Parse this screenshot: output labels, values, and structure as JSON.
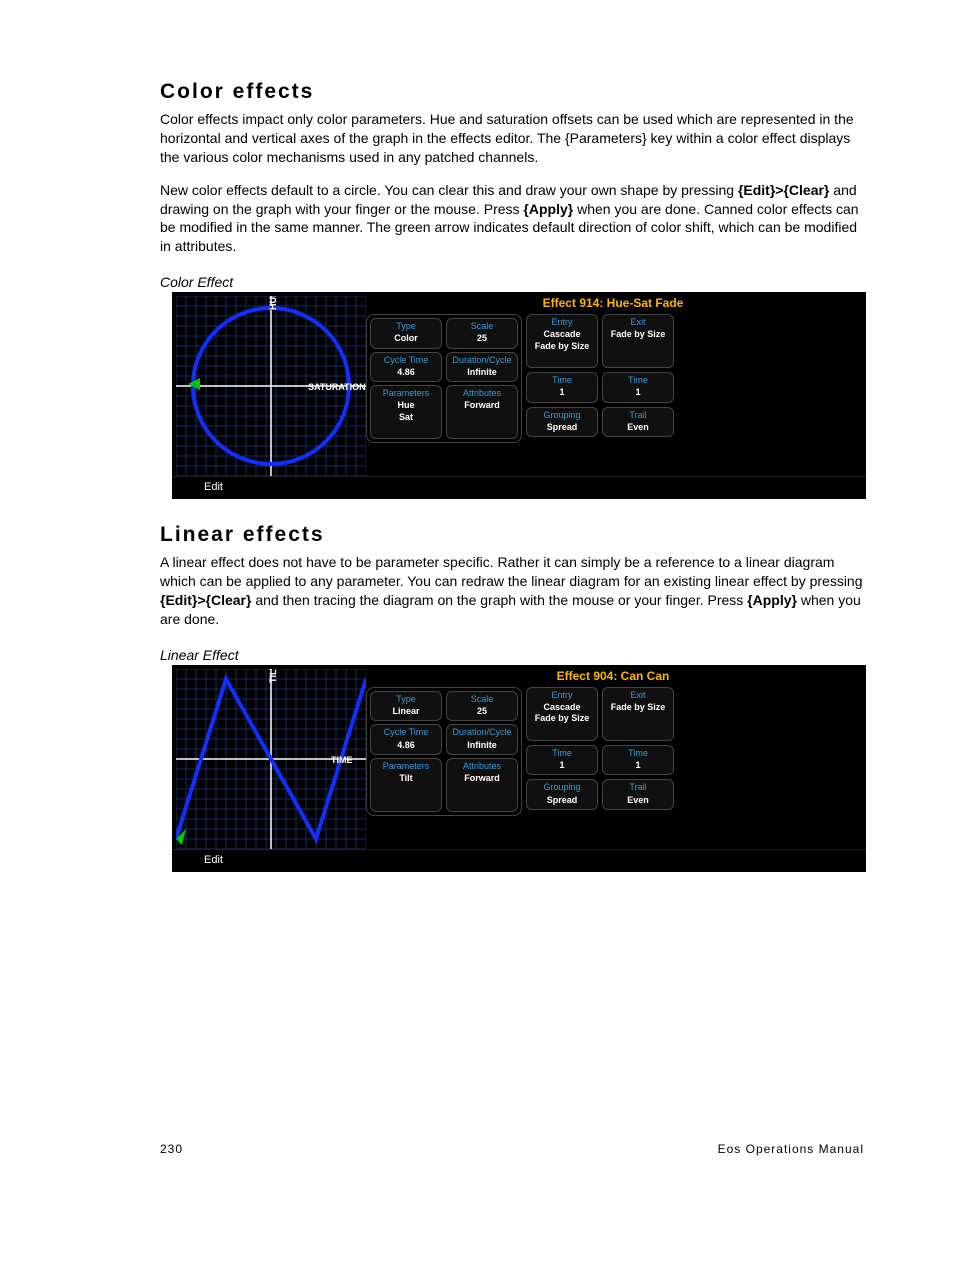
{
  "sections": {
    "color": {
      "heading": "Color effects",
      "p1": "Color effects impact only color parameters. Hue and saturation offsets can be used which are represented in the horizontal and vertical axes of the graph in the effects editor. The {Parameters} key within a color effect displays the various color mechanisms used in any patched channels.",
      "p2a": "New color effects default to a circle. You can clear this and draw your own shape by pressing ",
      "p2b": "{Edit}>{Clear}",
      "p2c": " and drawing on the graph with your finger or the mouse. Press ",
      "p2d": "{Apply}",
      "p2e": " when you are done. Canned color effects can be modified in the same manner. The green arrow indicates default direction of color shift, which can be modified in attributes.",
      "caption": "Color Effect"
    },
    "linear": {
      "heading": "Linear effects",
      "p1a": "A linear effect does not have to be parameter specific. Rather it can simply be a reference to a linear diagram which can be applied to any parameter. You can redraw the linear diagram for an existing linear effect by pressing ",
      "p1b": "{Edit}>{Clear}",
      "p1c": " and then tracing the diagram on the graph with the mouse or your finger. Press ",
      "p1d": "{Apply}",
      "p1e": " when you are done.",
      "caption": "Linear Effect"
    }
  },
  "screenshot_color": {
    "title": "Effect 914: Hue-Sat Fade",
    "axis_v": "HUE",
    "axis_h": "SATURATION",
    "edit": "Edit",
    "tiles": {
      "type": {
        "hdr": "Type",
        "val": "Color"
      },
      "scale": {
        "hdr": "Scale",
        "val": "25"
      },
      "cycle": {
        "hdr": "Cycle Time",
        "val": "4.86"
      },
      "duration": {
        "hdr": "Duration/Cycle",
        "val": "Infinite"
      },
      "params": {
        "hdr": "Parameters",
        "val1": "Hue",
        "val2": "Sat"
      },
      "attrs": {
        "hdr": "Attributes",
        "val": "Forward"
      },
      "entry": {
        "hdr": "Entry",
        "val1": "Cascade",
        "val2": "Fade by Size"
      },
      "exit": {
        "hdr": "Exit",
        "val": "Fade by Size"
      },
      "time1": {
        "hdr": "Time",
        "val": "1"
      },
      "time2": {
        "hdr": "Time",
        "val": "1"
      },
      "grouping": {
        "hdr": "Grouping",
        "val": "Spread"
      },
      "trail": {
        "hdr": "Trail",
        "val": "Even"
      }
    }
  },
  "screenshot_linear": {
    "title": "Effect 904: Can Can",
    "axis_v": "TILT",
    "axis_h": "TIME",
    "edit": "Edit",
    "tiles": {
      "type": {
        "hdr": "Type",
        "val": "Linear"
      },
      "scale": {
        "hdr": "Scale",
        "val": "25"
      },
      "cycle": {
        "hdr": "Cycle Time",
        "val": "4.86"
      },
      "duration": {
        "hdr": "Duration/Cycle",
        "val": "Infinite"
      },
      "params": {
        "hdr": "Parameters",
        "val1": "Tilt",
        "val2": ""
      },
      "attrs": {
        "hdr": "Attributes",
        "val": "Forward"
      },
      "entry": {
        "hdr": "Entry",
        "val1": "Cascade",
        "val2": "Fade by Size"
      },
      "exit": {
        "hdr": "Exit",
        "val": "Fade by Size"
      },
      "time1": {
        "hdr": "Time",
        "val": "1"
      },
      "time2": {
        "hdr": "Time",
        "val": "1"
      },
      "grouping": {
        "hdr": "Grouping",
        "val": "Spread"
      },
      "trail": {
        "hdr": "Trail",
        "val": "Even"
      }
    }
  },
  "footer": {
    "page": "230",
    "manual": "Eos Operations Manual"
  }
}
